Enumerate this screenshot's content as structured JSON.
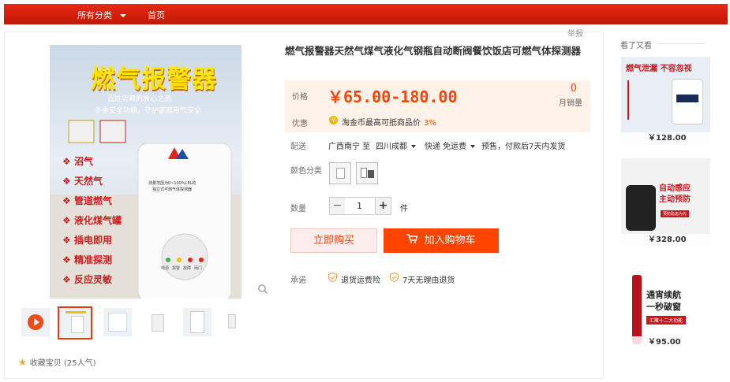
{
  "topbar": {
    "categories_label": "所有分类",
    "home_label": "首页"
  },
  "report_label": "举报",
  "gallery": {
    "main_text": {
      "headline": "燃气报警器",
      "subline1": "百姓信赖的放心之选",
      "subline2": "多重安全功能，守护家庭用气安全",
      "device_text1": "测量范围为0~100%LEL的",
      "device_text2": "独立式可燃气体探测器",
      "leds": [
        "电源",
        "报警",
        "故障",
        "阀门"
      ]
    },
    "features": [
      "沼气",
      "天然气",
      "管道燃气",
      "液化煤气罐",
      "插电即用",
      "精准探测",
      "反应灵敏"
    ]
  },
  "favorite": {
    "label": "收藏宝贝",
    "count_text": "(25人气)"
  },
  "product": {
    "title": "燃气报警器天然气煤气液化气钢瓶自动断阀餐饮饭店可燃气体探测器",
    "price_label": "价格",
    "price": "￥65.00-180.00",
    "sales_count": "0",
    "sales_label": "月销量",
    "promo_label": "优惠",
    "promo_text": "淘金币最高可抵商品价",
    "promo_pct": "3%",
    "shipping_label": "配送",
    "ship_from": "广西南宁 至",
    "ship_to": "四川成都",
    "ship_method": "快递 免运费",
    "ship_note": "预售，付款后7天内发货",
    "color_label": "颜色分类",
    "qty_label": "数量",
    "qty_value": "1",
    "qty_unit": "件",
    "buy_now": "立即购买",
    "add_cart": "加入购物车",
    "promise_label": "承诺",
    "promises": [
      "退货运费险",
      "7天无理由退货"
    ]
  },
  "sidebar": {
    "title": "看了又看",
    "items": [
      {
        "price": "￥128.00",
        "headline1": "燃气泄漏",
        "headline2": "不容忽视"
      },
      {
        "price": "￥328.00",
        "headline1": "自动感应",
        "headline2": "主动预防",
        "tag": "预防隐患为先"
      },
      {
        "price": "￥95.00",
        "headline1": "通宵续航",
        "headline2": "一秒破窗",
        "tag": "汇聚十二大功能"
      }
    ]
  },
  "colors": {
    "accent": "#ff4400",
    "brand_red": "#e52a11",
    "price_bg": "#fff2e8"
  }
}
